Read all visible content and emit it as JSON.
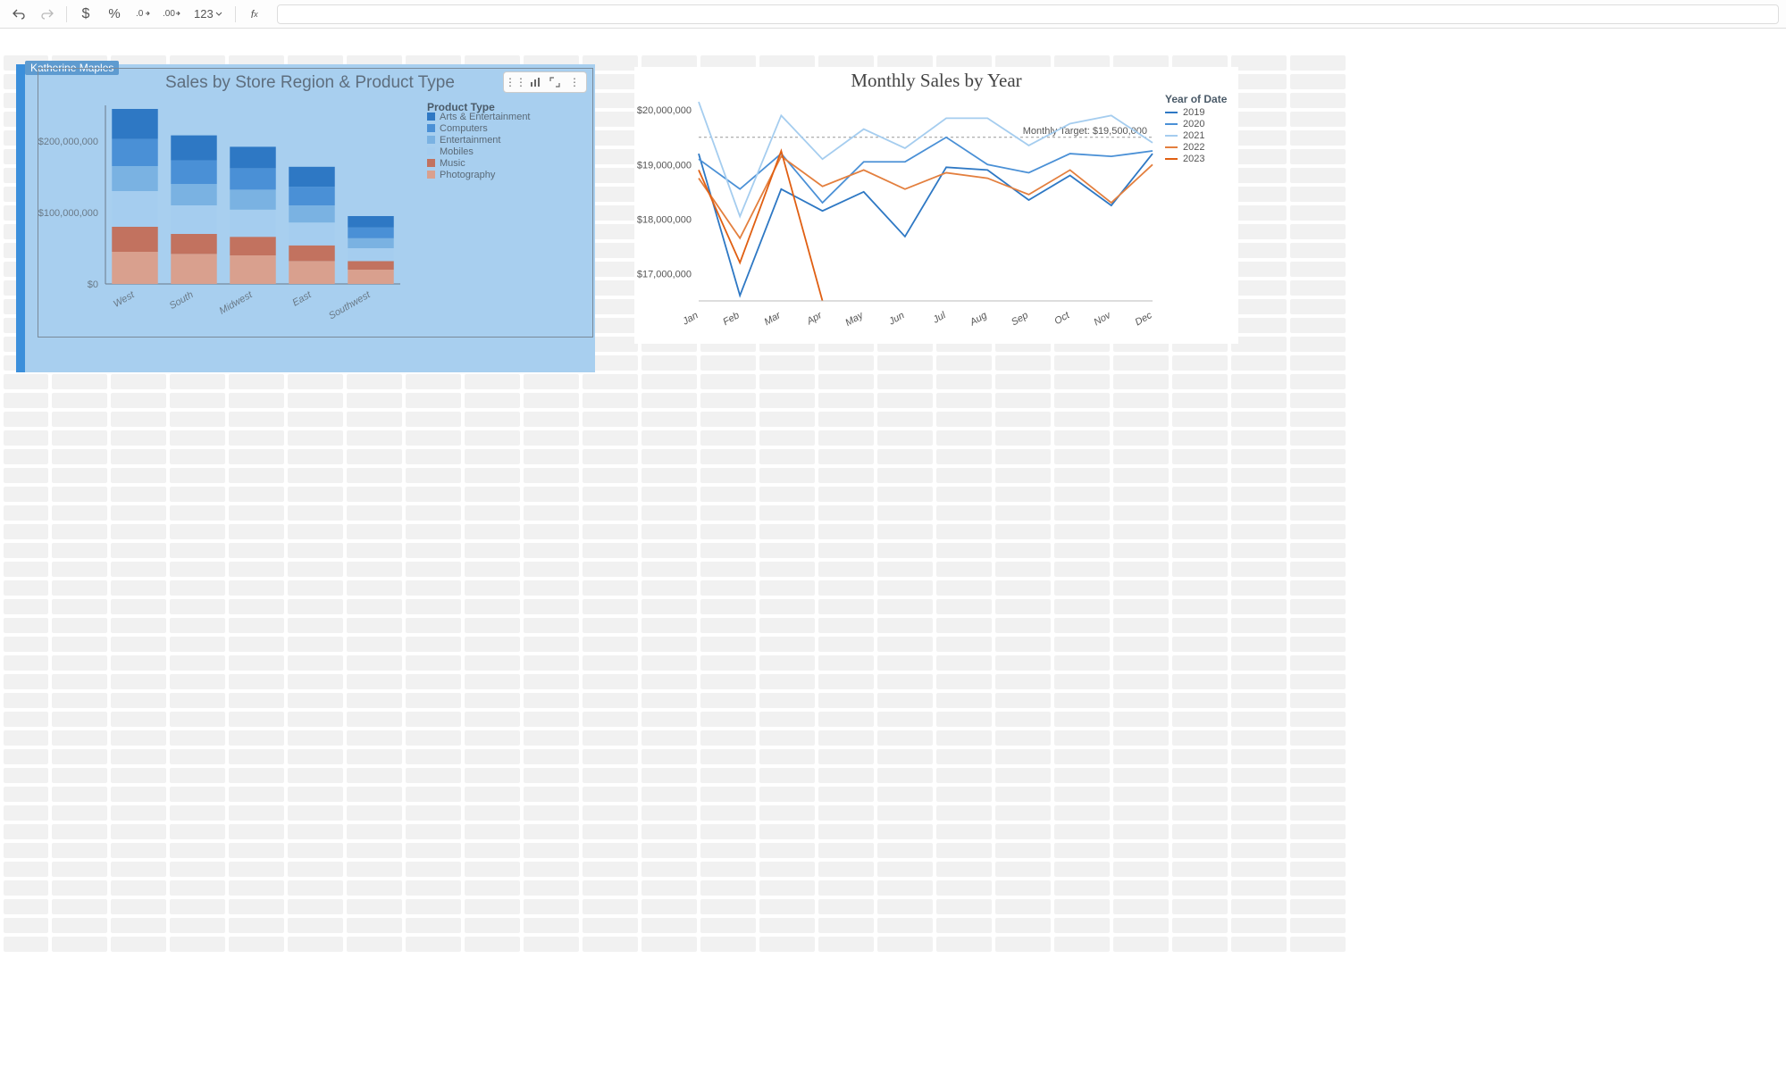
{
  "toolbar": {
    "format_123": "123"
  },
  "user_tag": "Katherine Maples",
  "chart_data": [
    {
      "id": "left",
      "type": "bar",
      "title": "Sales by Store Region & Product Type",
      "ylabel": "",
      "ylim": [
        0,
        250000000
      ],
      "y_ticks": [
        0,
        100000000,
        200000000
      ],
      "y_tick_labels": [
        "$0",
        "$100,000,000",
        "$200,000,000"
      ],
      "categories": [
        "West",
        "South",
        "Midwest",
        "East",
        "Southwest"
      ],
      "legend_title": "Product Type",
      "series": [
        {
          "name": "Arts & Entertainment",
          "color": "#2e78c4",
          "values": [
            42000000,
            35000000,
            30000000,
            28000000,
            16000000
          ]
        },
        {
          "name": "Computers",
          "color": "#4a90d6",
          "values": [
            38000000,
            33000000,
            30000000,
            26000000,
            15000000
          ]
        },
        {
          "name": "Entertainment",
          "color": "#7ab2e2",
          "values": [
            35000000,
            30000000,
            28000000,
            24000000,
            14000000
          ]
        },
        {
          "name": "Mobiles",
          "color": "#a5cdef",
          "values": [
            50000000,
            40000000,
            38000000,
            32000000,
            18000000
          ]
        },
        {
          "name": "Music",
          "color": "#c2725f",
          "values": [
            35000000,
            28000000,
            26000000,
            22000000,
            12000000
          ]
        },
        {
          "name": "Photography",
          "color": "#d9a08e",
          "values": [
            45000000,
            42000000,
            40000000,
            32000000,
            20000000
          ]
        }
      ]
    },
    {
      "id": "right",
      "type": "line",
      "title": "Monthly Sales by Year",
      "legend_title": "Year of Date",
      "ylim": [
        16500000,
        20200000
      ],
      "y_ticks": [
        17000000,
        18000000,
        19000000,
        20000000
      ],
      "y_tick_labels": [
        "$17,000,000",
        "$18,000,000",
        "$19,000,000",
        "$20,000,000"
      ],
      "x": [
        "Jan",
        "Feb",
        "Mar",
        "Apr",
        "May",
        "Jun",
        "Jul",
        "Aug",
        "Sep",
        "Oct",
        "Nov",
        "Dec"
      ],
      "reference_line": {
        "label": "Monthly Target: $19,500,000",
        "value": 19500000
      },
      "series": [
        {
          "name": "2019",
          "color": "#2e78c4",
          "values": [
            19200000,
            16600000,
            18550000,
            18150000,
            18500000,
            17680000,
            18950000,
            18900000,
            18350000,
            18800000,
            18250000,
            19200000
          ]
        },
        {
          "name": "2020",
          "color": "#4a90d6",
          "values": [
            19100000,
            18550000,
            19200000,
            18300000,
            19050000,
            19050000,
            19500000,
            19000000,
            18850000,
            19200000,
            19150000,
            19250000
          ]
        },
        {
          "name": "2021",
          "color": "#a5cdef",
          "values": [
            20150000,
            18050000,
            19900000,
            19100000,
            19650000,
            19300000,
            19850000,
            19850000,
            19350000,
            19750000,
            19900000,
            19400000
          ]
        },
        {
          "name": "2022",
          "color": "#e37f3e",
          "values": [
            18750000,
            17650000,
            19150000,
            18600000,
            18900000,
            18550000,
            18850000,
            18750000,
            18450000,
            18900000,
            18300000,
            19000000
          ]
        },
        {
          "name": "2023",
          "color": "#e05f12",
          "values": [
            18900000,
            17200000,
            19250000,
            16500000
          ]
        }
      ]
    }
  ]
}
